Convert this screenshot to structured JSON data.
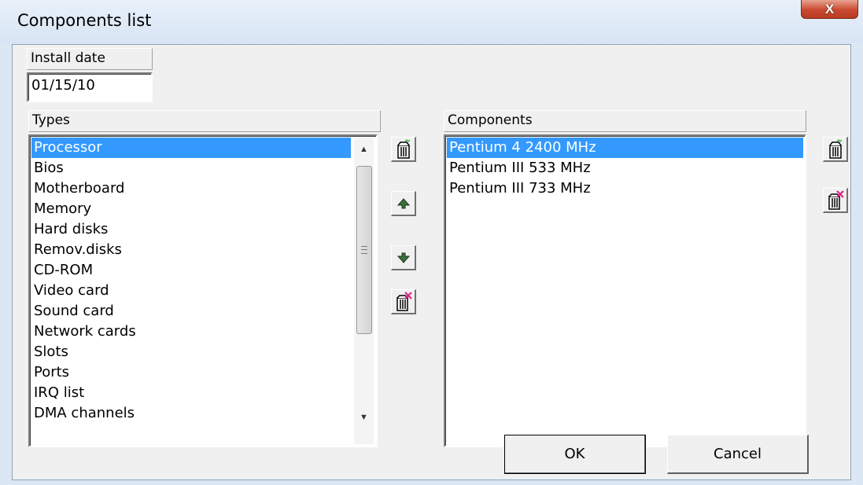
{
  "window": {
    "title": "Components list",
    "close_label": "X"
  },
  "install_date": {
    "label": "Install date",
    "value": "01/15/10"
  },
  "types": {
    "header": "Types",
    "selected_index": 0,
    "items": [
      "Processor",
      "Bios",
      "Motherboard",
      "Memory",
      "Hard disks",
      "Remov.disks",
      "CD-ROM",
      "Video card",
      "Sound card",
      "Network cards",
      "Slots",
      "Ports",
      "IRQ list",
      "DMA channels"
    ]
  },
  "components": {
    "header": "Components",
    "selected_index": 0,
    "items": [
      "Pentium 4 2400 MHz",
      "Pentium III 533 MHz",
      "Pentium III 733 MHz"
    ]
  },
  "toolbar_icons": {
    "types_add": "add-item-icon",
    "types_up": "move-up-icon",
    "types_down": "move-down-icon",
    "types_delete": "delete-item-icon",
    "components_add": "add-item-icon",
    "components_delete": "delete-item-icon"
  },
  "buttons": {
    "ok": "OK",
    "cancel": "Cancel"
  },
  "colors": {
    "selection": "#3399ff",
    "titlebar": "#dbe7f4",
    "close": "#c8492f",
    "delete_mark": "#e0218a"
  }
}
